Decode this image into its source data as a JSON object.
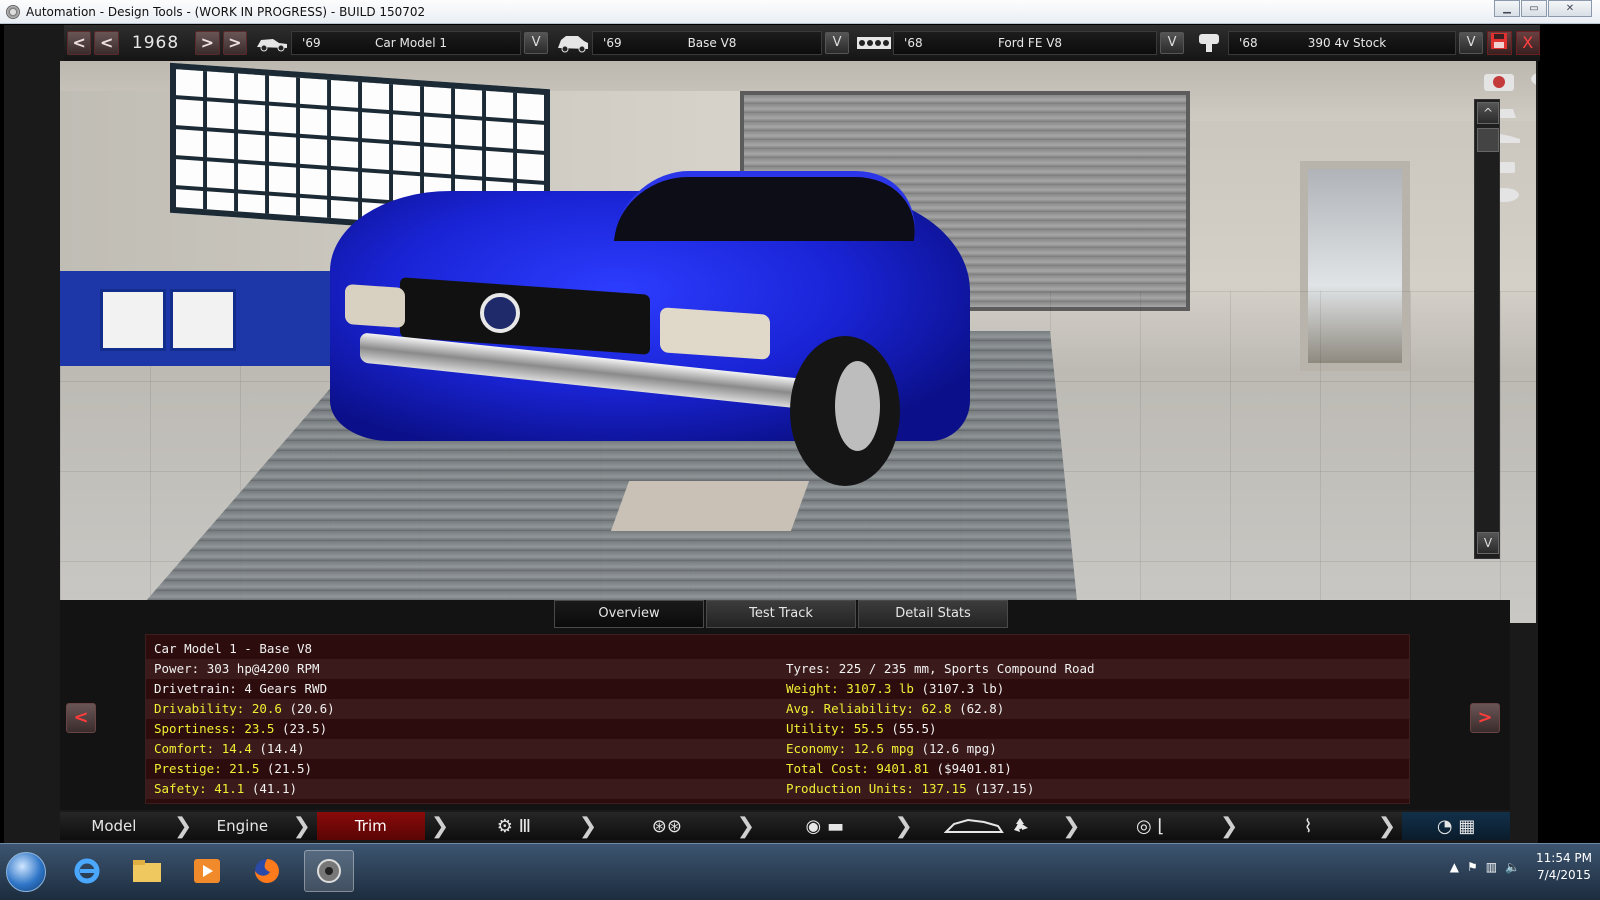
{
  "window": {
    "title": "Automation - Design Tools - (WORK IN PROGRESS) - BUILD 150702",
    "controls": {
      "minimize": "▭",
      "maximize": "▭",
      "close": "✕"
    }
  },
  "toolbar": {
    "prev_fast": "<",
    "prev": "<",
    "year": "1968",
    "next": ">",
    "next_fast": ">",
    "selectors": [
      {
        "icon": "car-model-icon",
        "year": "'69",
        "name": "Car Model 1",
        "dropdown": "V"
      },
      {
        "icon": "car-trim-icon",
        "year": "'69",
        "name": "Base V8",
        "dropdown": "V"
      },
      {
        "icon": "engine-block-icon",
        "year": "'68",
        "name": "Ford FE V8",
        "dropdown": "V"
      },
      {
        "icon": "piston-icon",
        "year": "'68",
        "name": "390 4v Stock",
        "dropdown": "V"
      }
    ],
    "save": "💾",
    "close": "X"
  },
  "viewport": {
    "scroll_up": "^",
    "scroll_down": "V"
  },
  "panel": {
    "tabs": [
      "Overview",
      "Test Track",
      "Detail Stats"
    ],
    "active_tab": "Overview",
    "prev": "<",
    "next": ">",
    "stats": [
      {
        "left": {
          "label": "Car Model 1 - Base V8",
          "value": "",
          "paren": "",
          "color": "white"
        },
        "right": null
      },
      {
        "left": {
          "label": "Power:",
          "value": "303 hp@4200 RPM",
          "paren": "",
          "color": "white"
        },
        "right": {
          "label": "Tyres:",
          "value": "225 / 235 mm, Sports Compound Road",
          "paren": "",
          "color": "white"
        }
      },
      {
        "left": {
          "label": "Drivetrain:",
          "value": "4 Gears RWD",
          "paren": "",
          "color": "white"
        },
        "right": {
          "label": "Weight:",
          "value": "3107.3 lb",
          "paren": "(3107.3 lb)",
          "color": "yellow"
        }
      },
      {
        "left": {
          "label": "Drivability:",
          "value": "20.6",
          "paren": "(20.6)",
          "color": "yellow"
        },
        "right": {
          "label": "Avg. Reliability:",
          "value": "62.8",
          "paren": "(62.8)",
          "color": "yellow"
        }
      },
      {
        "left": {
          "label": "Sportiness:",
          "value": "23.5",
          "paren": "(23.5)",
          "color": "yellow"
        },
        "right": {
          "label": "Utility:",
          "value": "55.5",
          "paren": "(55.5)",
          "color": "yellow"
        }
      },
      {
        "left": {
          "label": "Comfort:",
          "value": "14.4",
          "paren": "(14.4)",
          "color": "yellow"
        },
        "right": {
          "label": "Economy:",
          "value": "12.6 mpg",
          "paren": "(12.6 mpg)",
          "color": "yellow"
        }
      },
      {
        "left": {
          "label": "Prestige:",
          "value": "21.5",
          "paren": "(21.5)",
          "color": "yellow"
        },
        "right": {
          "label": "Total Cost:",
          "value": "9401.81",
          "paren": "($9401.81)",
          "color": "yellow"
        }
      },
      {
        "left": {
          "label": "Safety:",
          "value": "41.1",
          "paren": "(41.1)",
          "color": "yellow"
        },
        "right": {
          "label": "Production Units:",
          "value": "137.15",
          "paren": "(137.15)",
          "color": "yellow"
        }
      }
    ]
  },
  "bottom_nav": {
    "model": "Model",
    "engine": "Engine",
    "trim": "Trim",
    "active": "Trim",
    "icons": [
      "gearbox-icon",
      "wheels-icon",
      "body-icon",
      "aero-cooling-icon",
      "interior-icon",
      "suspension-icon",
      "test-icon"
    ]
  },
  "taskbar": {
    "apps": [
      "internet-explorer-icon",
      "file-explorer-icon",
      "media-player-icon",
      "firefox-icon",
      "automation-icon"
    ],
    "time": "11:54 PM",
    "date": "7/4/2015"
  },
  "colors": {
    "accent_red": "#8a0a0a",
    "stat_yellow": "#f1ef35",
    "car_blue": "#1a24d6",
    "stats_bg": "#2c0c0c"
  }
}
